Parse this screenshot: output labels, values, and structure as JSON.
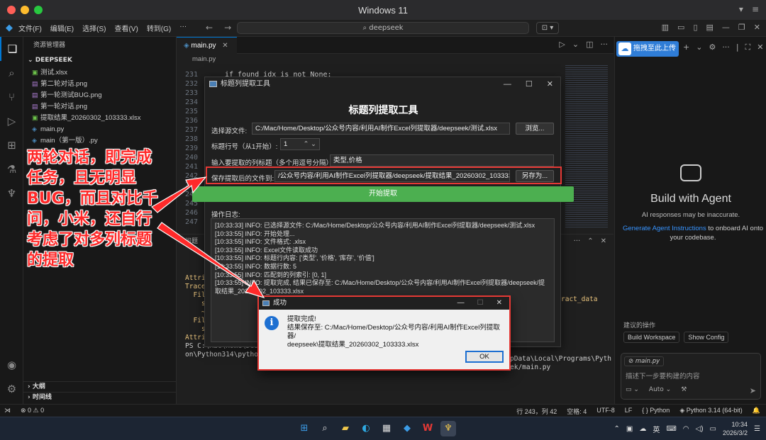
{
  "mac": {
    "title": "Windows 11"
  },
  "vscode": {
    "menu": [
      "文件(F)",
      "编辑(E)",
      "选择(S)",
      "查看(V)",
      "转到(G)"
    ],
    "search_placeholder": "deepseek"
  },
  "explorer": {
    "header": "资源管理器",
    "folder": "DEEPSEEK",
    "files": [
      {
        "name": "测试.xlsx",
        "icon": "excel-icon",
        "color": "#6cc24a"
      },
      {
        "name": "第二轮对话.png",
        "icon": "image-icon",
        "color": "#b180d7"
      },
      {
        "name": "第一轮测试BUG.png",
        "icon": "image-icon",
        "color": "#b180d7"
      },
      {
        "name": "第一轮对话.png",
        "icon": "image-icon",
        "color": "#b180d7"
      },
      {
        "name": "提取结果_20260302_103333.xlsx",
        "icon": "excel-icon",
        "color": "#6cc24a"
      },
      {
        "name": "main.py",
        "icon": "python-icon",
        "color": "#4b8bbe"
      },
      {
        "name": "main（第一版）.py",
        "icon": "python-icon",
        "color": "#4b8bbe"
      }
    ],
    "outline": "大纲",
    "timeline": "时间线"
  },
  "editor": {
    "tab": "main.py",
    "breadcrumb": "main.py",
    "line_numbers": [
      "231",
      "232",
      "233",
      "234",
      "235",
      "236",
      "237",
      "238",
      "239",
      "240",
      "241",
      "242",
      "243",
      "244",
      "245",
      "246",
      "247"
    ],
    "code_line_231": "if found_idx is not None:",
    "panel_label": "问题"
  },
  "terminal": {
    "lines": [
      "Attrib",
      "Trace",
      "  Fil",
      "    s",
      "    ~",
      "  Fil",
      "    s",
      "",
      "AttributeError: 'P",
      "PS C:\\Mac\\Home\\Desk",
      "on\\Python314\\python"
    ],
    "right_frag_1": "ract_data",
    "right_frag_2": "pData\\Local\\Programs\\Pyth",
    "right_frag_3": "ek/main.py"
  },
  "tool": {
    "window_title": "标题列提取工具",
    "heading": "标题列提取工具",
    "source_label": "选择源文件:",
    "source_value": "C:/Mac/Home/Desktop/公众号内容/利用AI制作Excel列提取器/deepseek/测试.xlsx",
    "browse_btn": "浏览...",
    "header_row_label": "标题行号（从1开始）:",
    "header_row_value": "1",
    "columns_label": "输入要提取的列标题（多个用逗号分隔）:",
    "columns_value": "类型,价格",
    "save_label": "保存提取后的文件到:",
    "save_value": "/公众号内容/利用AI制作Excel列提取器/deepseek/提取结果_20260302_103333.xlsx",
    "save_as_btn": "另存为...",
    "start_btn": "开始提取",
    "log_label": "操作日志:",
    "log": [
      "[10:33:33] INFO: 已选择源文件: C:/Mac/Home/Desktop/公众号内容/利用AI制作Excel列提取器/deepseek/测试.xlsx",
      "[10:33:55] INFO: 开始处理...",
      "[10:33:55] INFO: 文件格式: .xlsx",
      "[10:33:55] INFO: Excel文件读取成功",
      "[10:33:55] INFO: 标题行内容: ['类型', '价格', '库存', '价值']",
      "[10:33:55] INFO: 数据行数: 5",
      "[10:33:55] INFO: 匹配到的列索引: [0, 1]",
      "[10:33:55] INFO: 提取完成, 结果已保存至: C:/Mac/Home/Desktop/公众号内容/利用AI制作Excel列提取器/deepseek/提",
      "取结果_20260302_103333.xlsx"
    ]
  },
  "dialog": {
    "title": "成功",
    "line1": "提取完成!",
    "line2": "结果保存至: C:/Mac/Home/Desktop/公众号内容/利用AI制作Excel列提取器/",
    "line3": "deepseek\\提取结果_20260302_103333.xlsx",
    "ok": "OK"
  },
  "annotation": "两轮对话，即完成任务，且无明显BUG，而且对比千问，小米，还自行考虑了对多列标题的提取",
  "chat": {
    "upload_btn": "拖拽至此上传",
    "title": "Build with Agent",
    "subtitle": "AI responses may be inaccurate.",
    "link": "Generate Agent Instructions",
    "link_rest": " to onboard AI onto your codebase.",
    "suggest_label": "建议的操作",
    "suggest_1": "Build Workspace",
    "suggest_2": "Show Config",
    "chip": "main.py",
    "placeholder": "描述下一步要构建的内容",
    "auto": "Auto"
  },
  "status": {
    "errors": "⊗ 0 ⚠ 0",
    "position": "行 243，列 42",
    "spaces": "空格: 4",
    "encoding": "UTF-8",
    "eol": "LF",
    "lang": "Python",
    "interpreter": "Python 3.14 (64-bit)"
  },
  "taskbar": {
    "ime": "英",
    "time": "10:34",
    "date": "2026/3/2"
  }
}
